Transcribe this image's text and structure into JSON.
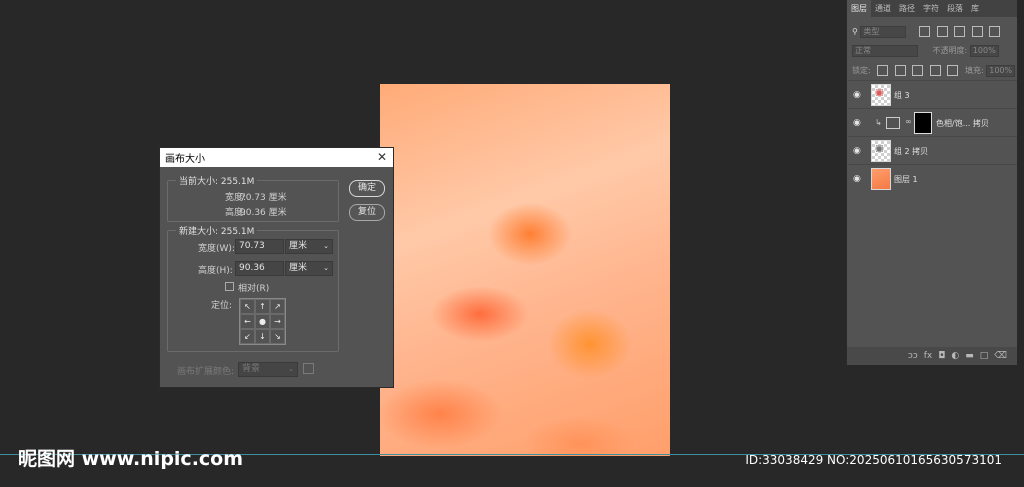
{
  "dialog": {
    "title": "画布大小",
    "current_size_label": "当前大小: 255.1M",
    "current_width_label": "宽度:",
    "current_width_value": "70.73 厘米",
    "current_height_label": "高度:",
    "current_height_value": "90.36 厘米",
    "new_size_label": "新建大小: 255.1M",
    "width_label": "宽度(W):",
    "width_value": "70.73",
    "width_unit": "厘米",
    "height_label": "高度(H):",
    "height_value": "90.36",
    "height_unit": "厘米",
    "relative_label": "相对(R)",
    "anchor_label": "定位:",
    "anchor_arrows": [
      "↖",
      "↑",
      "↗",
      "←",
      "●",
      "→",
      "↙",
      "↓",
      "↘"
    ],
    "extension_color_label": "画布扩展颜色:",
    "extension_color_value": "背景",
    "ok_button": "确定",
    "reset_button": "复位"
  },
  "layers_panel": {
    "tabs": [
      "图层",
      "通道",
      "路径",
      "字符",
      "段落",
      "库"
    ],
    "filter_placeholder": "类型",
    "blend_mode": "正常",
    "opacity_label": "不透明度:",
    "opacity_value": "100%",
    "lock_label": "锁定:",
    "fill_label": "填充:",
    "fill_value": "100%",
    "layers": [
      {
        "name": "组 3",
        "visible": true
      },
      {
        "name": "色相/饱... 拷贝",
        "visible": true
      },
      {
        "name": "组 2 拷贝",
        "visible": true
      },
      {
        "name": "图层 1",
        "visible": true
      }
    ],
    "bottom_icons": [
      "ↄↄ",
      "fx",
      "◘",
      "◐",
      "▬",
      "□",
      "⌫"
    ]
  },
  "watermark": {
    "left": "昵图网 www.nipic.com",
    "right": "ID:33038429 NO:20250610165630573101"
  }
}
